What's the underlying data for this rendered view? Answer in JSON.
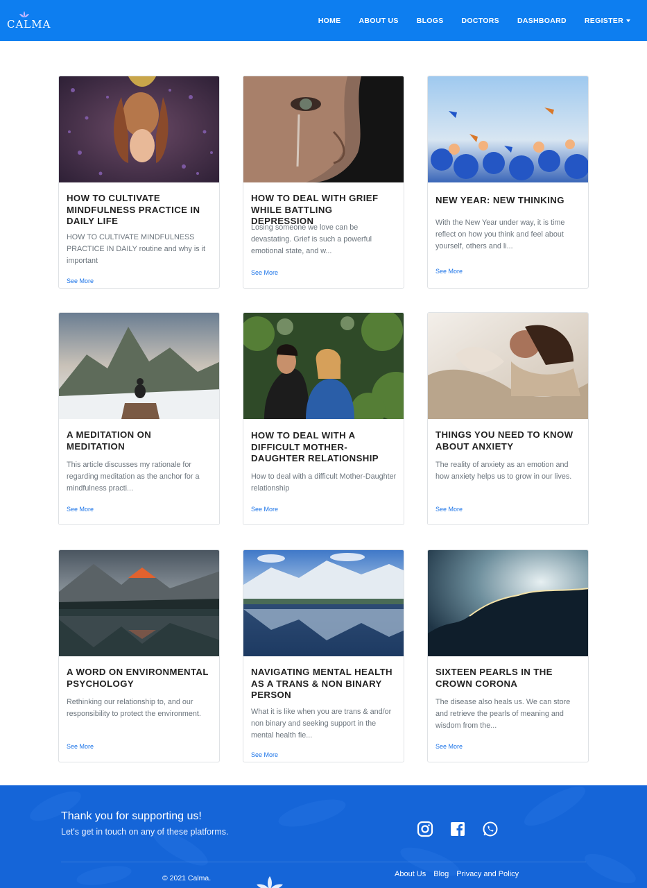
{
  "brand": {
    "name": "CALMA"
  },
  "nav": {
    "items": [
      {
        "label": "HOME"
      },
      {
        "label": "ABOUT US"
      },
      {
        "label": "BLOGS"
      },
      {
        "label": "DOCTORS"
      },
      {
        "label": "DASHBOARD"
      },
      {
        "label": "REGISTER"
      }
    ]
  },
  "cards": [
    {
      "title": "HOW TO CULTIVATE MINDFULNESS PRACTICE IN DAILY LIFE",
      "text": "HOW TO CULTIVATE MINDFULNESS PRACTICE IN DAILY routine and why is it important",
      "link": "See More",
      "image": "woman lying in lavender field"
    },
    {
      "title": "HOW TO DEAL WITH GRIEF WHILE BATTLING DEPRESSION",
      "text": "Losing someone we love can be devastating. Grief is such a powerful emotional state, and w...",
      "link": "See More",
      "image": "woman crying close-up"
    },
    {
      "title": "NEW YEAR: NEW THINKING",
      "text": "With the New Year under way, it is time reflect on how you think and feel about yourself, others and li...",
      "link": "See More",
      "image": "butterflies and blue flowers"
    },
    {
      "title": "A MEDITATION ON MEDITATION",
      "text": "This article discusses my rationale for regarding meditation as the anchor for a mindfulness practi...",
      "link": "See More",
      "image": "person meditating on mountain"
    },
    {
      "title": "HOW TO DEAL WITH A DIFFICULT MOTHER-DAUGHTER RELATIONSHIP",
      "text": "How to deal with a difficult Mother-Daughter relationship",
      "link": "See More",
      "image": "mother and daughter outdoors"
    },
    {
      "title": "THINGS YOU NEED TO KNOW ABOUT ANXIETY",
      "text": "The reality of anxiety as an emotion and how anxiety helps us to grow in our lives.",
      "link": "See More",
      "image": "woman relaxing on bed"
    },
    {
      "title": "A WORD ON ENVIRONMENTAL PSYCHOLOGY",
      "text": "Rethinking our relationship to, and our responsibility to protect the environment.",
      "link": "See More",
      "image": "mountain reflected in lake"
    },
    {
      "title": "NAVIGATING MENTAL HEALTH AS A TRANS & NON BINARY PERSON",
      "text": "What it is like when you are trans & and/or non binary and seeking support in the mental health fie...",
      "link": "See More",
      "image": "snowy mountain lake"
    },
    {
      "title": "SIXTEEN PEARLS IN THE CROWN CORONA",
      "text": "The disease also heals us. We can store and retrieve the pearls of meaning and wisdom from the...",
      "link": "See More",
      "image": "sunlit cloud silhouette"
    }
  ],
  "footer": {
    "thanks": "Thank you for supporting us!",
    "touch": "Let's get in touch on any of these platforms.",
    "socials": [
      "instagram-icon",
      "facebook-icon",
      "whatsapp-icon"
    ],
    "copyright": "© 2021 Calma.",
    "links": [
      {
        "label": "About Us"
      },
      {
        "label": "Blog"
      },
      {
        "label": "Privacy and Policy"
      }
    ]
  },
  "colors": {
    "primary": "#0d7ef0",
    "footer": "#1565d8",
    "link": "#1a73e8"
  }
}
